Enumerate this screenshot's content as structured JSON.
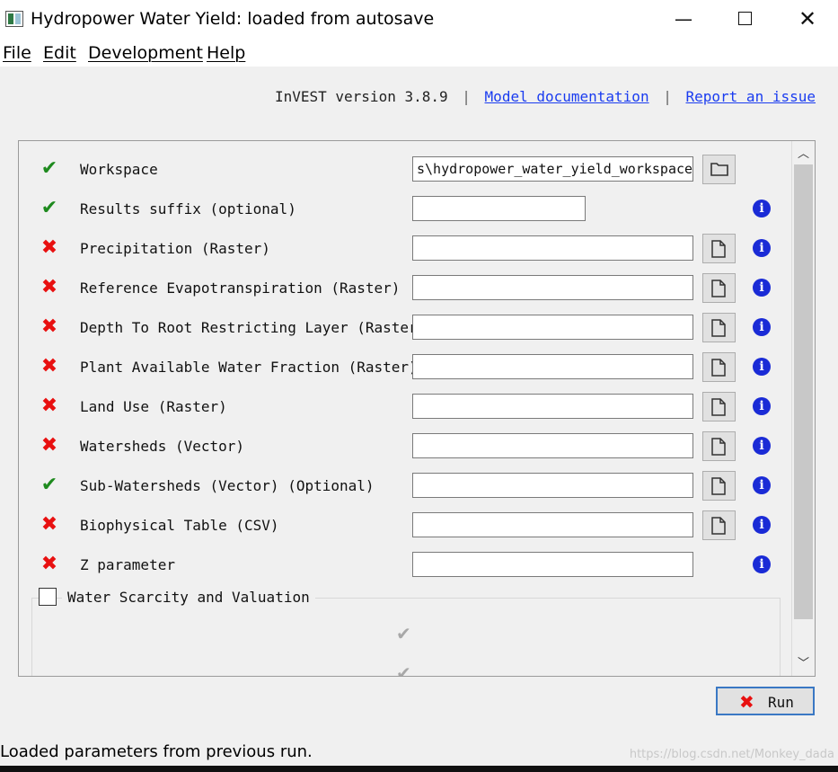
{
  "window": {
    "title": "Hydropower Water Yield: loaded from autosave",
    "minimize_glyph": "—",
    "close_glyph": "✕"
  },
  "menu": [
    "File",
    "Edit",
    "Development",
    "Help"
  ],
  "header": {
    "version": "InVEST version 3.8.9",
    "separator": "|",
    "doc_link": "Model documentation",
    "issue_link": "Report an issue"
  },
  "inputs": [
    {
      "label": "Workspace",
      "status": "ok",
      "value": "s\\hydropower_water_yield_workspace",
      "browse": "folder-icon",
      "info": false
    },
    {
      "label": "Results suffix (optional)",
      "status": "ok",
      "value": "",
      "browse": "none",
      "info": true
    },
    {
      "label": "Precipitation (Raster)",
      "status": "error",
      "value": "",
      "browse": "file-icon",
      "info": true
    },
    {
      "label": "Reference Evapotranspiration (Raster)",
      "status": "error",
      "value": "",
      "browse": "file-icon",
      "info": true
    },
    {
      "label": "Depth To Root Restricting Layer (Raster)",
      "status": "error",
      "value": "",
      "browse": "file-icon",
      "info": true
    },
    {
      "label": "Plant Available Water Fraction (Raster)",
      "status": "error",
      "value": "",
      "browse": "file-icon",
      "info": true
    },
    {
      "label": "Land Use (Raster)",
      "status": "error",
      "value": "",
      "browse": "file-icon",
      "info": true
    },
    {
      "label": "Watersheds (Vector)",
      "status": "error",
      "value": "",
      "browse": "file-icon",
      "info": true
    },
    {
      "label": "Sub-Watersheds (Vector) (Optional)",
      "status": "ok",
      "value": "",
      "browse": "file-icon",
      "info": true
    },
    {
      "label": "Biophysical Table (CSV)",
      "status": "error",
      "value": "",
      "browse": "file-icon",
      "info": true
    },
    {
      "label": "Z parameter",
      "status": "error",
      "value": "",
      "browse": "none",
      "info": true
    }
  ],
  "valuation_group": {
    "label": "Water Scarcity and Valuation",
    "checked": false
  },
  "glyphs": {
    "ok": "✔",
    "error": "✖",
    "info": "i",
    "scroll_up": "︿",
    "scroll_down": "﹀"
  },
  "colors": {
    "ok": "#1e8a1e",
    "error": "#e81010",
    "info": "#1a2bd6",
    "link": "#1a3cf0"
  },
  "run_button": {
    "label": "Run",
    "icon": "✖"
  },
  "status_bar": "Loaded parameters from previous run.",
  "watermark": "https://blog.csdn.net/Monkey_dada"
}
